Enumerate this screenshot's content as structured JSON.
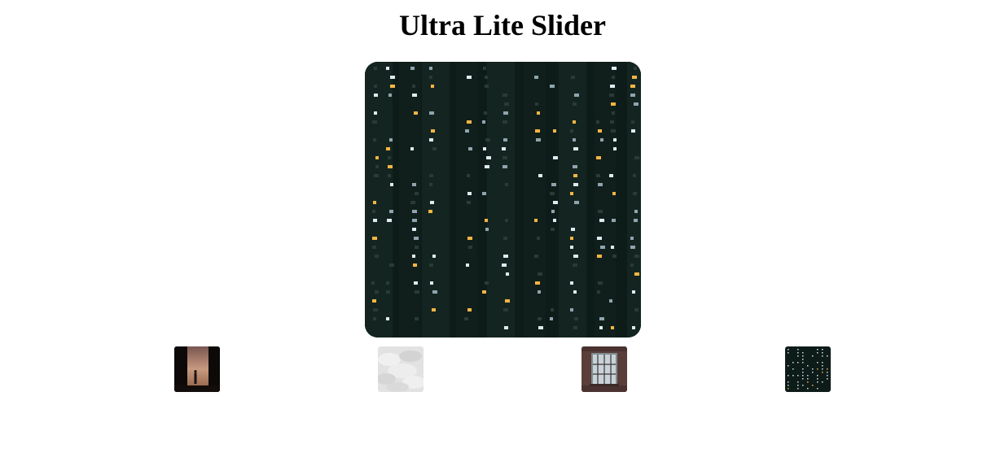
{
  "slider": {
    "title": "Ultra Lite Slider",
    "active_index": 3,
    "images": [
      {
        "name": "silhouette-in-doorway-photo"
      },
      {
        "name": "white-fabric-texture-photo"
      },
      {
        "name": "barred-window-photo"
      },
      {
        "name": "night-apartment-building-photo"
      }
    ]
  }
}
